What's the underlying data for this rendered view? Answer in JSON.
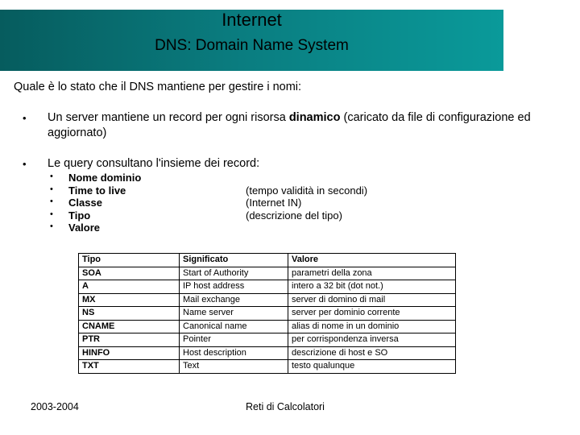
{
  "header": {
    "title": "Internet",
    "subtitle": "DNS: Domain Name System",
    "gradient_start": "#065c5e",
    "gradient_mid": "#0a7d80",
    "gradient_end": "#0a9a9a",
    "text_color": "#000000"
  },
  "body": {
    "lead": "Quale è lo stato che il DNS mantiene per gestire i nomi:",
    "bullet_marker": "•",
    "bullets": [
      {
        "text_before": "Un server mantiene un record per ogni risorsa ",
        "emphasis": "dinamico",
        "text_after": " (caricato da file di configurazione ed aggiornato)"
      },
      {
        "text_before": "Le query consultano l'insieme dei record:",
        "emphasis": "",
        "text_after": ""
      }
    ],
    "subbullets": [
      {
        "label": "Nome dominio",
        "desc": ""
      },
      {
        "label": "Time to live",
        "desc": "(tempo validità in secondi)"
      },
      {
        "label": "Classe",
        "desc": "(Internet IN)"
      },
      {
        "label": "Tipo",
        "desc": "(descrizione del tipo)"
      },
      {
        "label": "Valore",
        "desc": ""
      }
    ]
  },
  "table": {
    "headers": [
      "Tipo",
      "Significato",
      "Valore"
    ],
    "rows": [
      [
        "SOA",
        "Start of Authority",
        "parametri della zona"
      ],
      [
        "A",
        "IP host address",
        "intero a 32 bit (dot not.)"
      ],
      [
        "MX",
        "Mail exchange",
        "server di domino di mail"
      ],
      [
        "NS",
        "Name server",
        "server per dominio corrente"
      ],
      [
        "CNAME",
        "Canonical name",
        "alias di nome in un dominio"
      ],
      [
        "PTR",
        "Pointer",
        "per corrispondenza inversa"
      ],
      [
        "HINFO",
        "Host description",
        "descrizione di host e SO"
      ],
      [
        "TXT",
        "Text",
        "testo qualunque"
      ]
    ]
  },
  "footer": {
    "left": "2003-2004",
    "center": "Reti di Calcolatori"
  }
}
